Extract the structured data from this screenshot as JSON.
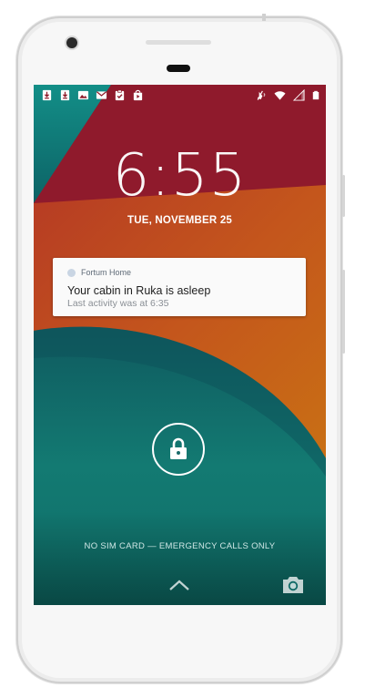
{
  "status_bar": {
    "left_icons": [
      "download-icon",
      "download-icon",
      "image-icon",
      "gmail-icon",
      "clipboard-check-icon",
      "play-store-icon"
    ],
    "right_icons": [
      "vibrate-mute-icon",
      "wifi-icon",
      "signal-icon",
      "battery-icon"
    ]
  },
  "lockscreen": {
    "time": "6:55",
    "date": "TUE, NOVEMBER 25",
    "emergency_text": "NO SIM CARD — EMERGENCY CALLS ONLY"
  },
  "notification": {
    "app_name": "Fortum Home",
    "title": "Your cabin in Ruka is asleep",
    "text": "Last activity was at 6:35"
  },
  "colors": {
    "wallpaper_red": "#8e1b2a",
    "wallpaper_orange": "#c4561c",
    "wallpaper_teal": "#11706c",
    "wallpaper_dark_teal": "#0f4a55"
  }
}
